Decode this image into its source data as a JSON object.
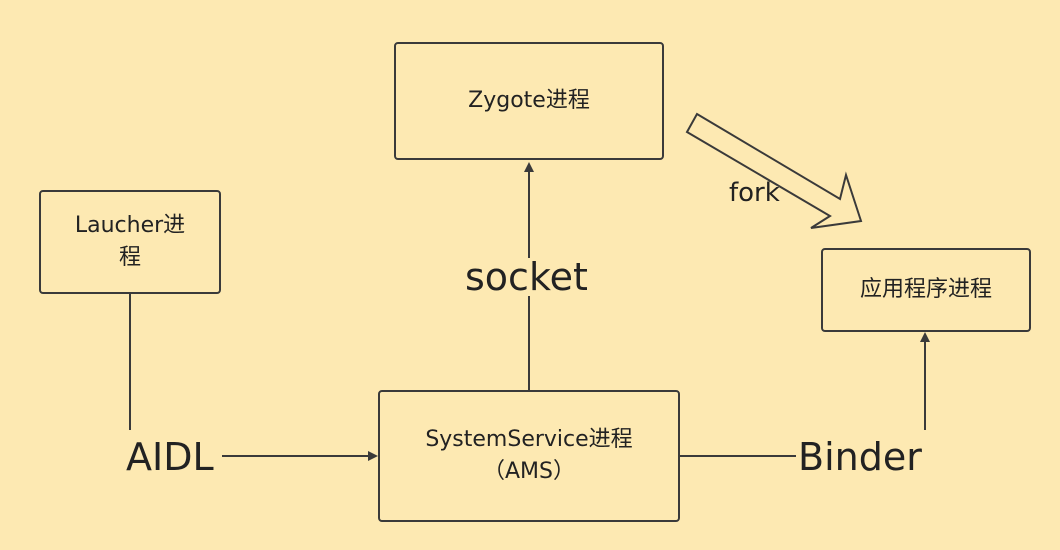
{
  "nodes": {
    "zygote": "Zygote进程",
    "launcher_line1": "Laucher进",
    "launcher_line2": "程",
    "app": "应用程序进程",
    "system_line1": "SystemService进程",
    "system_line2": "（AMS）"
  },
  "edges": {
    "aidl": "AIDL",
    "socket": "socket",
    "binder": "Binder",
    "fork": "fork"
  },
  "colors": {
    "background": "#fde9b2",
    "stroke": "#3a3a3a"
  }
}
